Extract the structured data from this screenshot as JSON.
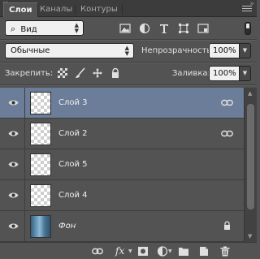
{
  "panel": {
    "close_glyph": "×",
    "collapse_glyph": "»",
    "tabs": [
      {
        "label": "Слои",
        "active": true
      },
      {
        "label": "Каналы",
        "active": false
      },
      {
        "label": "Контуры",
        "active": false
      }
    ]
  },
  "filter": {
    "kind_search_glyph": "⌕",
    "kind_label": "Вид",
    "icons": [
      "pixel-filter-icon",
      "adjustment-filter-icon",
      "type-filter-icon",
      "shape-filter-icon",
      "smart-object-filter-icon"
    ]
  },
  "blend": {
    "mode": "Обычные",
    "opacity_label": "Непрозрачность:",
    "opacity_value": "100%"
  },
  "lock": {
    "label": "Закрепить:",
    "icons": [
      "lock-transparent-icon",
      "lock-image-icon",
      "lock-position-icon",
      "lock-all-icon"
    ],
    "fill_label": "Заливка:",
    "fill_value": "100%"
  },
  "layers": [
    {
      "name": "Слой 3",
      "selected": true,
      "linked": true,
      "thumb": "transparent"
    },
    {
      "name": "Слой 2",
      "selected": false,
      "linked": true,
      "thumb": "transparent"
    },
    {
      "name": "Слой 5",
      "selected": false,
      "linked": false,
      "thumb": "transparent"
    },
    {
      "name": "Слой 4",
      "selected": false,
      "linked": false,
      "thumb": "transparent"
    },
    {
      "name": "Фон",
      "selected": false,
      "linked": false,
      "locked": true,
      "thumb": "photo"
    }
  ],
  "bottom_toolbar": {
    "fx_label": "fx",
    "icons": [
      "link-layers-icon",
      "fx-icon",
      "add-mask-icon",
      "adjustment-layer-icon",
      "new-group-icon",
      "new-layer-icon",
      "delete-icon"
    ]
  },
  "colors": {
    "panel_bg": "#535353",
    "selected_row": "#6b7d98",
    "header_bg": "#3c3c3c"
  }
}
